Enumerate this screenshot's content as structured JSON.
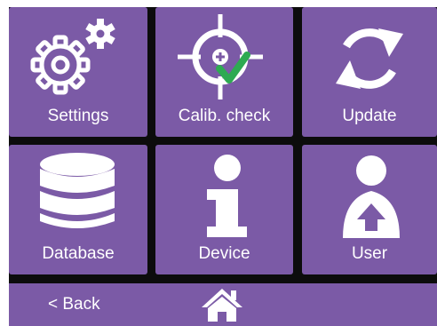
{
  "tiles": [
    {
      "label": "Settings",
      "icon": "gears-icon"
    },
    {
      "label": "Calib. check",
      "icon": "crosshair-check-icon"
    },
    {
      "label": "Update",
      "icon": "refresh-icon"
    },
    {
      "label": "Database",
      "icon": "database-icon"
    },
    {
      "label": "Device",
      "icon": "info-icon"
    },
    {
      "label": "User",
      "icon": "user-upload-icon"
    }
  ],
  "bottom_bar": {
    "back_label": "< Back",
    "home_icon": "home-icon"
  },
  "colors": {
    "tile": "#7b5aa6",
    "background": "#0c0c0c",
    "check": "#2eaa52",
    "icon": "#ffffff"
  }
}
